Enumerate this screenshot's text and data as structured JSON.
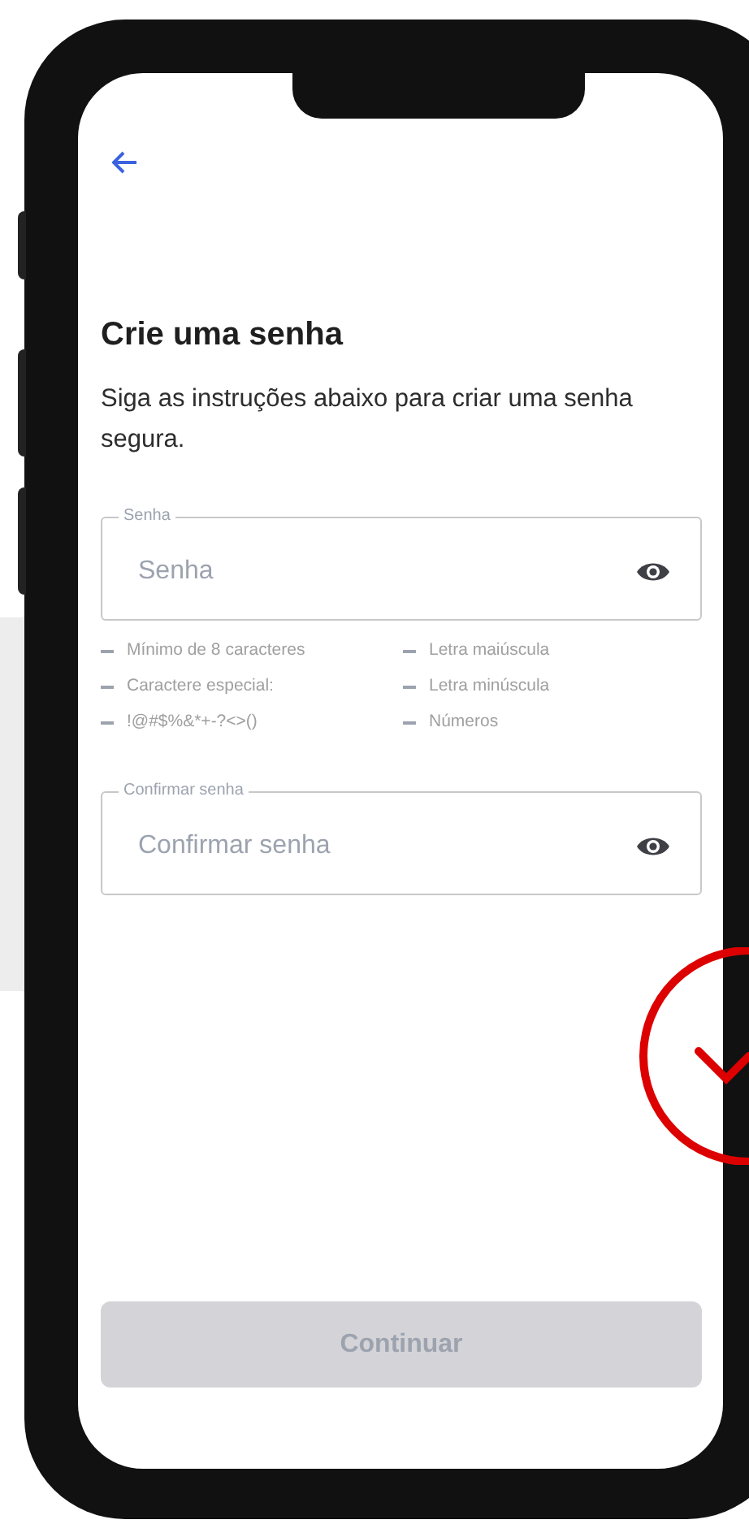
{
  "screen": {
    "title": "Crie uma senha",
    "subtitle": "Siga as instruções abaixo para criar uma senha segura."
  },
  "fields": [
    {
      "label": "Senha",
      "placeholder": "Senha"
    },
    {
      "label": "Confirmar senha",
      "placeholder": "Confirmar senha"
    }
  ],
  "requirements": [
    [
      "Mínimo de 8 caracteres",
      "Caractere especial:",
      "!@#$%&*+-?<>()"
    ],
    [
      "Letra maiúscula",
      "Letra minúscula",
      "Números"
    ]
  ],
  "button": {
    "label": "Continuar",
    "disabled": true
  }
}
